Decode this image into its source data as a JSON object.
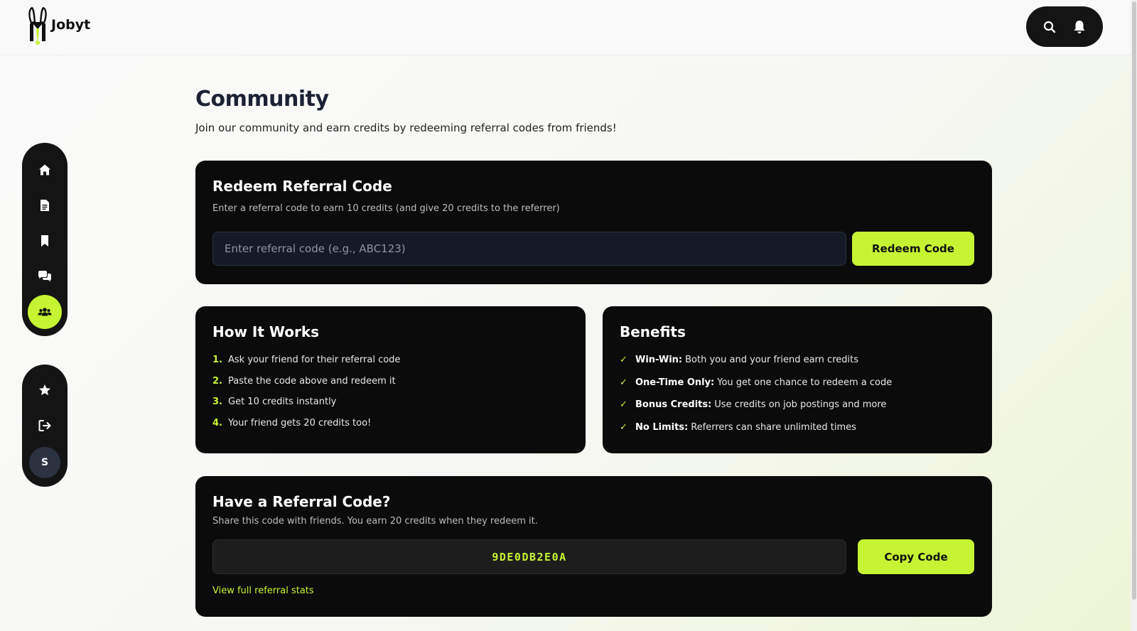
{
  "app": {
    "name": "Jobyt"
  },
  "header": {
    "search_icon": "search-icon",
    "notifications_icon": "bell-icon"
  },
  "sidebar": {
    "primary_items": [
      {
        "icon": "home-icon",
        "active": false
      },
      {
        "icon": "document-icon",
        "active": false
      },
      {
        "icon": "bookmark-icon",
        "active": false
      },
      {
        "icon": "chat-icon",
        "active": false
      },
      {
        "icon": "community-icon",
        "active": true
      }
    ],
    "secondary_items": [
      {
        "icon": "star-icon"
      },
      {
        "icon": "logout-icon"
      }
    ],
    "avatar_initial": "S"
  },
  "page": {
    "title": "Community",
    "subtitle": "Join our community and earn credits by redeeming referral codes from friends!"
  },
  "redeem": {
    "title": "Redeem Referral Code",
    "description": "Enter a referral code to earn 10 credits (and give 20 credits to the referrer)",
    "input_value": "",
    "input_placeholder": "Enter referral code (e.g., ABC123)",
    "button_label": "Redeem Code"
  },
  "how_it_works": {
    "title": "How It Works",
    "steps": [
      {
        "num": "1.",
        "text": "Ask your friend for their referral code"
      },
      {
        "num": "2.",
        "text": "Paste the code above and redeem it"
      },
      {
        "num": "3.",
        "text": "Get 10 credits instantly"
      },
      {
        "num": "4.",
        "text": "Your friend gets 20 credits too!"
      }
    ]
  },
  "benefits": {
    "title": "Benefits",
    "items": [
      {
        "check": "✓",
        "bold": "Win-Win:",
        "text": "Both you and your friend earn credits"
      },
      {
        "check": "✓",
        "bold": "One-Time Only:",
        "text": "You get one chance to redeem a code"
      },
      {
        "check": "✓",
        "bold": "Bonus Credits:",
        "text": "Use credits on job postings and more"
      },
      {
        "check": "✓",
        "bold": "No Limits:",
        "text": "Referrers can share unlimited times"
      }
    ]
  },
  "share": {
    "title": "Have a Referral Code?",
    "description": "Share this code with friends. You earn 20 credits when they redeem it.",
    "code": "9DE0DB2E0A",
    "button_label": "Copy Code",
    "stats_link": "View full referral stats"
  },
  "colors": {
    "accent": "#c6f432",
    "card_bg": "#0b0b0b",
    "input_bg": "#151a26"
  }
}
